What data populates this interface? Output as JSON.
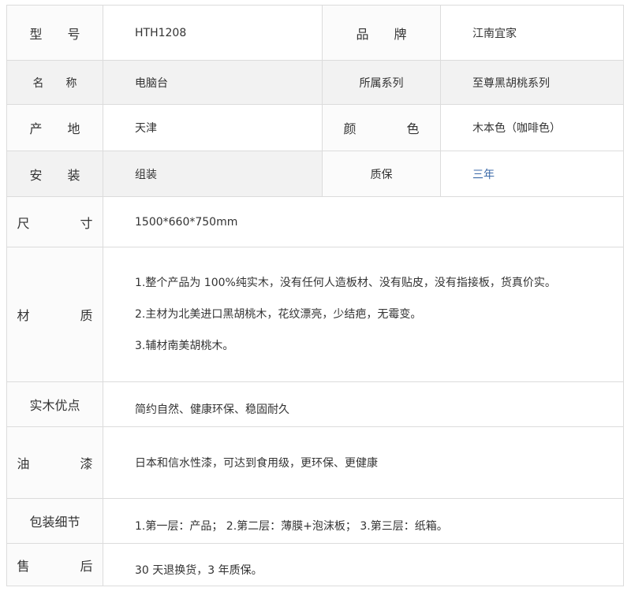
{
  "rows": {
    "r1": {
      "l1": "型　　号",
      "v1": "HTH1208",
      "l2": "品　　牌",
      "v2": "江南宜家"
    },
    "r2": {
      "l1": "名　　称",
      "v1": "电脑台",
      "l2": "所属系列",
      "v2": "至尊黑胡桃系列"
    },
    "r3": {
      "l1": "产　　地",
      "v1": "天津",
      "l2": "颜　　　　色",
      "v2": "木本色（咖啡色）"
    },
    "r4": {
      "l1": "安　　装",
      "v1": "组装",
      "l2": "质保",
      "v2": "三年"
    },
    "r5": {
      "l1": "尺　　　　寸",
      "v1": "1500*660*750mm"
    },
    "r6": {
      "l1": "材　　　　质",
      "lines": [
        "1.整个产品为 100%纯实木，没有任何人造板材、没有贴皮，没有指接板，货真价实。",
        "2.主材为北美进口黑胡桃木，花纹漂亮，少结疤，无霉变。",
        "3.辅材南美胡桃木。"
      ]
    },
    "r7": {
      "l1": "实木优点",
      "v1": "简约自然、健康环保、稳固耐久"
    },
    "r8": {
      "l1": "油　　　　漆",
      "v1": "日本和信水性漆，可达到食用级，更环保、更健康"
    },
    "r9": {
      "l1": "包装细节",
      "v1": "1.第一层：产品； 2.第二层：薄膜+泡沫板； 3.第三层：纸箱。"
    },
    "r10": {
      "l1": "售　　　　后",
      "v1": "30 天退换货，3 年质保。"
    }
  }
}
